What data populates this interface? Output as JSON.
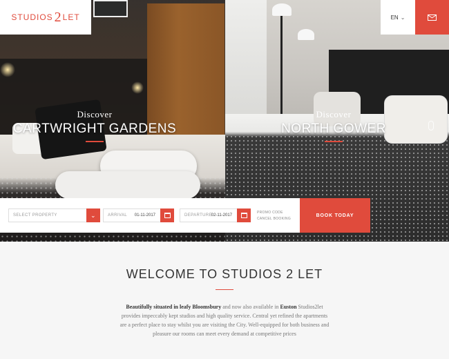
{
  "header": {
    "logo_word1": "STUDIOS",
    "logo_number": "2",
    "logo_word2": "LET",
    "language": "EN",
    "language_chevron": "chevron-down-icon",
    "mail_icon": "mail-icon"
  },
  "hero": {
    "left": {
      "kicker": "Discover",
      "name": "CARTWRIGHT GARDENS"
    },
    "right": {
      "kicker": "Discover",
      "name": "NORTH GOWER"
    }
  },
  "booking": {
    "select_property_placeholder": "SELECT PROPERTY",
    "arrival_label": "ARRIVAL",
    "arrival_value": "01-11-2017",
    "departure_label": "DEPARTURE",
    "departure_value": "02-11-2017",
    "promo_code": "PROMO CODE",
    "cancel_booking": "CANCEL BOOKING",
    "book_button": "BOOK TODAY"
  },
  "welcome": {
    "title": "WELCOME TO STUDIOS 2 LET",
    "intro_bold1": "Beautifully situated in leafy Bloomsbury",
    "intro_mid": " and now also available in ",
    "intro_bold2": "Euston",
    "intro_rest": " Studios2let provides impeccably kept studios and high quality service. Central yet refined the apartments are a perfect place to stay whilst you are visiting the City. Well-equipped for both business and pleasure our rooms can meet every demand at competitive prices"
  },
  "colors": {
    "accent": "#e04b3c",
    "background": "#f6f6f6"
  }
}
